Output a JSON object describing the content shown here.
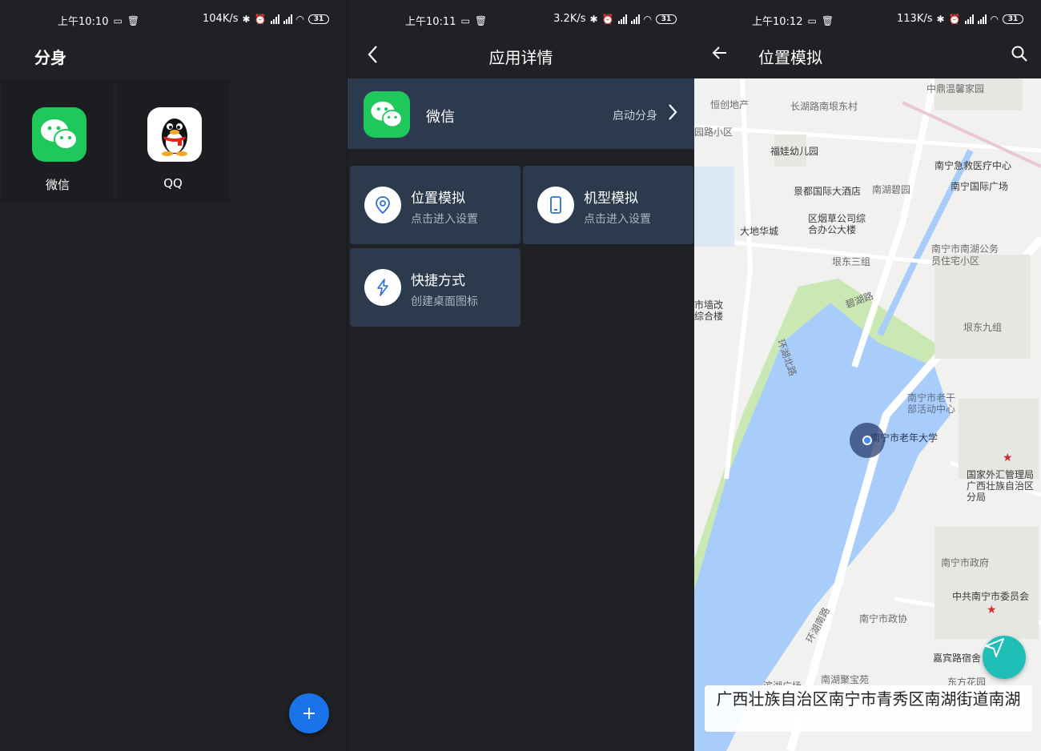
{
  "status_bars": [
    {
      "time": "上午10:10",
      "speed": "104K/s",
      "battery": "31"
    },
    {
      "time": "上午10:11",
      "speed": "3.2K/s",
      "battery": "31"
    },
    {
      "time": "上午10:12",
      "speed": "113K/s",
      "battery": "31"
    }
  ],
  "clone_screen": {
    "title": "分身",
    "apps": [
      {
        "name": "微信",
        "icon": "wechat-icon"
      },
      {
        "name": "QQ",
        "icon": "qq-penguin-icon"
      }
    ],
    "fab_label": "+"
  },
  "detail_screen": {
    "title": "应用详情",
    "back_icon": "chevron-left-icon",
    "app_name": "微信",
    "app_action": "启动分身",
    "cards": [
      {
        "title": "位置模拟",
        "subtitle": "点击进入设置",
        "icon": "location-pin-icon"
      },
      {
        "title": "机型模拟",
        "subtitle": "点击进入设置",
        "icon": "phone-icon"
      },
      {
        "title": "快捷方式",
        "subtitle": "创建桌面图标",
        "icon": "lightning-icon"
      }
    ]
  },
  "location_screen": {
    "title": "位置模拟",
    "back_icon": "arrow-left-icon",
    "search_icon": "search-icon",
    "address": "广西壮族自治区南宁市青秀区南湖街道南湖",
    "map_labels": [
      "中鼎温馨家园",
      "长湖路南垠东村",
      "恒创地产",
      "园路小区",
      "福娃幼儿园",
      "南宁急救医疗中心",
      "南宁国际广场",
      "景都国际大酒店",
      "南湖碧园",
      "区烟草公司综合办公大楼",
      "大地华城",
      "南宁市南湖公务员住宅小区",
      "垠东三组",
      "碧湖路",
      "垠东九组",
      "市墙改综合楼",
      "环湖北路",
      "南宁市老干部活动中心",
      "南宁市老年大学",
      "国家外汇管理局广西壮族自治区分局",
      "南宁市政府",
      "中共南宁市委员会",
      "南宁市政协",
      "环湖南路",
      "嘉宾路宿舍",
      "南湖聚宝苑",
      "东方花园",
      "滨湖广场"
    ],
    "colors": {
      "water": "#a9cdfb",
      "park": "#c9e8b4",
      "land": "#f1f1ef",
      "fab": "#1fbfb8"
    }
  },
  "colors": {
    "bg": "#1f2125",
    "card": "#2c3a4e",
    "accent": "#1a73e8",
    "wechat": "#1ec85b"
  }
}
